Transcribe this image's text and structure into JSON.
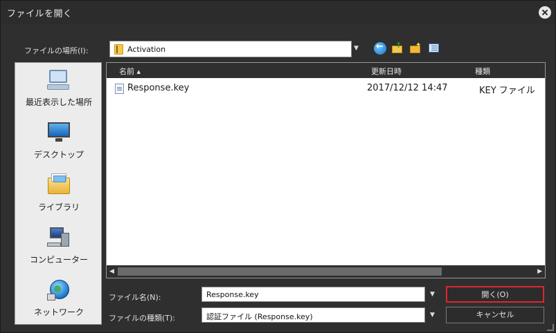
{
  "window": {
    "title": "ファイルを開く"
  },
  "lookin": {
    "label": "ファイルの場所(I):",
    "value": "Activation"
  },
  "toolbar": {
    "back": "back-icon",
    "up": "up-folder-icon",
    "newfolder": "new-folder-icon",
    "view": "view-menu-icon"
  },
  "places": [
    {
      "label": "最近表示した場所",
      "icon": "recent-places-icon"
    },
    {
      "label": "デスクトップ",
      "icon": "desktop-icon"
    },
    {
      "label": "ライブラリ",
      "icon": "libraries-icon"
    },
    {
      "label": "コンピューター",
      "icon": "computer-icon"
    },
    {
      "label": "ネットワーク",
      "icon": "network-icon"
    }
  ],
  "filelist": {
    "columns": {
      "name": "名前 ▴",
      "date": "更新日時",
      "type": "種類"
    },
    "rows": [
      {
        "name": "Response.key",
        "date": "2017/12/12 14:47",
        "type": "KEY ファイル"
      }
    ]
  },
  "filename": {
    "label": "ファイル名(N):",
    "value": "Response.key"
  },
  "filetype": {
    "label": "ファイルの種類(T):",
    "value": "認証ファイル (Response.key)"
  },
  "buttons": {
    "open": "開く(O)",
    "cancel": "キャンセル"
  },
  "colors": {
    "accent_highlight": "#e0262a",
    "dialog_bg": "#2f2f2f"
  }
}
